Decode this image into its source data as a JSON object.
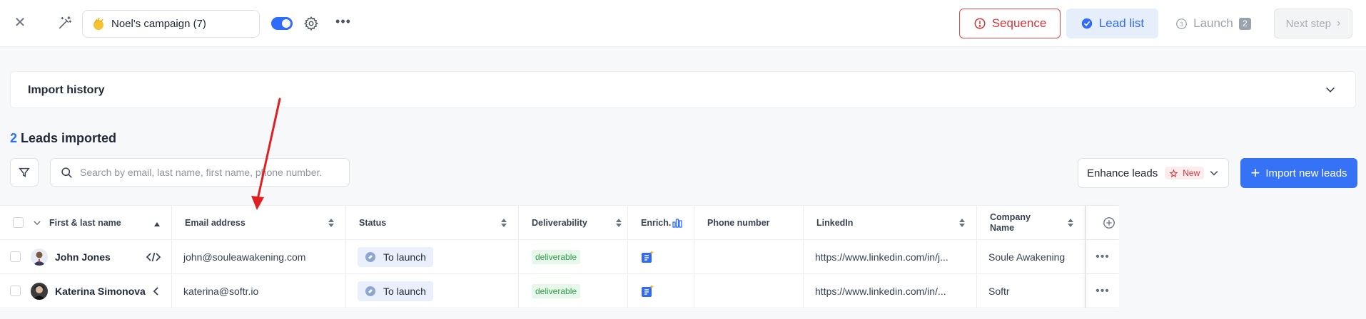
{
  "topbar": {
    "campaign_name": "Noel's campaign (7)",
    "sequence_label": "Sequence",
    "lead_list_label": "Lead list",
    "launch_label": "Launch",
    "launch_count": "2",
    "next_step_label": "Next step"
  },
  "import_history": {
    "title": "Import history"
  },
  "leads": {
    "count": "2",
    "label": "Leads imported"
  },
  "search": {
    "placeholder": "Search by email, last name, first name, phone number."
  },
  "enhance": {
    "label": "Enhance leads",
    "badge": "New"
  },
  "import_button": {
    "label": "Import new leads"
  },
  "table": {
    "columns": [
      "First & last name",
      "Email address",
      "Status",
      "Deliverability",
      "Enrich.",
      "Phone number",
      "LinkedIn",
      "Company Name"
    ],
    "rows": [
      {
        "name": "John Jones",
        "action_icon": "code-icon",
        "email": "john@souleawakening.com",
        "status": "To launch",
        "deliverability": "deliverable",
        "phone": "",
        "linkedin": "https://www.linkedin.com/in/j...",
        "company": "Soule Awakening"
      },
      {
        "name": "Katerina Simonova",
        "action_icon": "chevron-left-icon",
        "email": "katerina@softr.io",
        "status": "To launch",
        "deliverability": "deliverable",
        "phone": "",
        "linkedin": "https://www.linkedin.com/in/...",
        "company": "Softr"
      }
    ]
  },
  "colors": {
    "primary": "#3572f5",
    "danger": "#d6343a",
    "success": "#2f9e48",
    "annotation_arrow": "#e02020"
  }
}
